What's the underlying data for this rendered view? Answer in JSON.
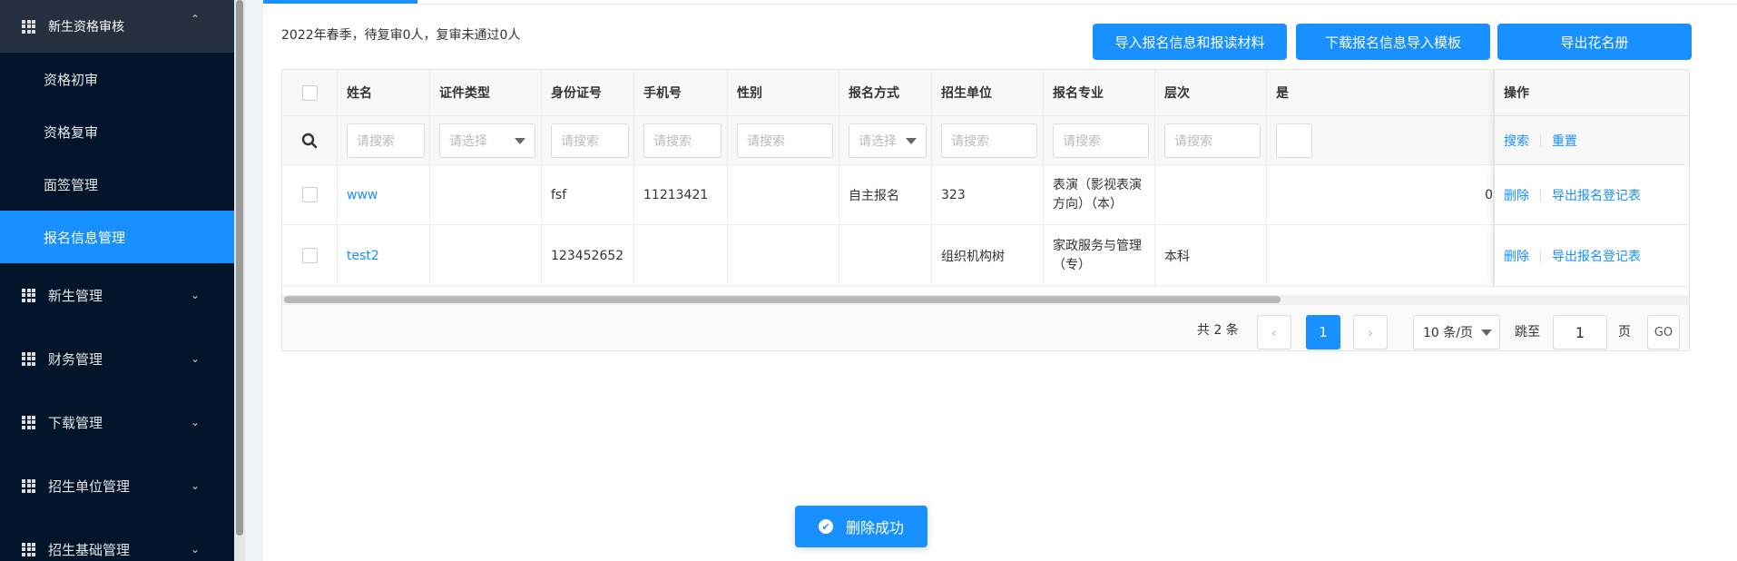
{
  "sidebar": {
    "top_group": "新生资格审核",
    "sub_items": [
      "资格初审",
      "资格复审",
      "面签管理",
      "报名信息管理"
    ],
    "groups": [
      "新生管理",
      "财务管理",
      "下载管理",
      "招生单位管理",
      "招生基础管理"
    ],
    "up_chevron": "⌃",
    "down_chevron": "⌄"
  },
  "summary": "2022年春季，待复审0人，复审未通过0人",
  "buttons": {
    "import": "导入报名信息和报读材料",
    "download_template": "下载报名信息导入模板",
    "export_roster": "导出花名册"
  },
  "table": {
    "headers": [
      "姓名",
      "证件类型",
      "身份证号",
      "手机号",
      "性别",
      "报名方式",
      "招生单位",
      "报名专业",
      "层次",
      "是",
      "操作"
    ],
    "filters": {
      "search_placeholder": "请搜索",
      "select_placeholder": "请选择",
      "search_action": "搜索",
      "reset_action": "重置"
    },
    "rows": [
      {
        "name": "www",
        "id_type": "",
        "id_number": "fsf",
        "phone": "11213421",
        "gender": "",
        "reg_method": "自主报名",
        "unit": "323",
        "major": "表演（影视表演方向）（本）",
        "level": "",
        "extra": "0",
        "delete": "删除",
        "export": "导出报名登记表"
      },
      {
        "name": "test2",
        "id_type": "",
        "id_number": "123452652",
        "phone": "",
        "gender": "",
        "reg_method": "",
        "unit": "组织机构树",
        "major": "家政服务与管理（专）",
        "level": "本科",
        "extra": "",
        "delete": "删除",
        "export": "导出报名登记表"
      }
    ]
  },
  "pagination": {
    "total": "共 2 条",
    "current_page": "1",
    "page_size": "10 条/页",
    "jump_label": "跳至",
    "jump_value": "1",
    "page_unit": "页",
    "go": "GO",
    "prev": "‹",
    "next": "›"
  },
  "toast": {
    "message": "删除成功",
    "icon": "✔"
  }
}
